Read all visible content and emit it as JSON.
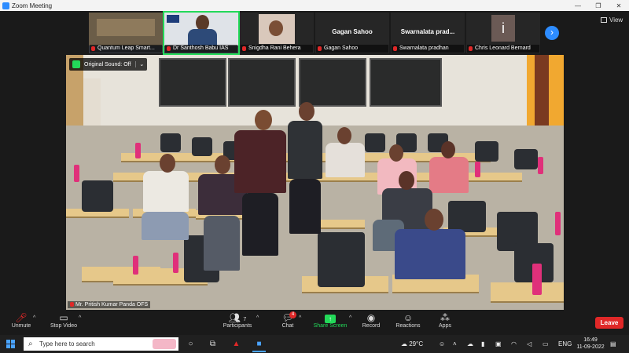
{
  "window": {
    "title": "Zoom Meeting",
    "minimize": "—",
    "maximize": "❐",
    "close": "✕"
  },
  "view_button": {
    "label": "View"
  },
  "participants_strip": [
    {
      "name": "Quantum Leap Smart...",
      "muted": true,
      "kind": "video"
    },
    {
      "name": "Dr Santhosh Babu IAS",
      "muted": true,
      "kind": "video"
    },
    {
      "name": "Snigdha Rani Behera",
      "muted": true,
      "kind": "video"
    },
    {
      "name": "Gagan Sahoo",
      "muted": true,
      "kind": "name",
      "big_name": "Gagan Sahoo"
    },
    {
      "name": "Swarnalata pradhan",
      "muted": true,
      "kind": "name",
      "big_name": "Swarnalata prad..."
    },
    {
      "name": "Chris Leonard Bernard",
      "muted": true,
      "kind": "initial",
      "initial": "i"
    }
  ],
  "main_video": {
    "original_sound": "Original Sound: Off",
    "speaker_name": "Mr. Pritish Kumar Panda OFS"
  },
  "toolbar": {
    "unmute": "Unmute",
    "stop_video": "Stop Video",
    "participants": "Participants",
    "participants_count": "7",
    "chat": "Chat",
    "chat_badge": "4",
    "share_screen": "Share Screen",
    "record": "Record",
    "reactions": "Reactions",
    "apps": "Apps",
    "leave": "Leave"
  },
  "taskbar": {
    "search_placeholder": "Type here to search",
    "weather": "29°C",
    "language": "ENG",
    "time": "16:49",
    "date": "11-09-2022"
  },
  "colors": {
    "accent": "#2d8cff",
    "active_speaker": "#23d959",
    "leave": "#e02828"
  }
}
